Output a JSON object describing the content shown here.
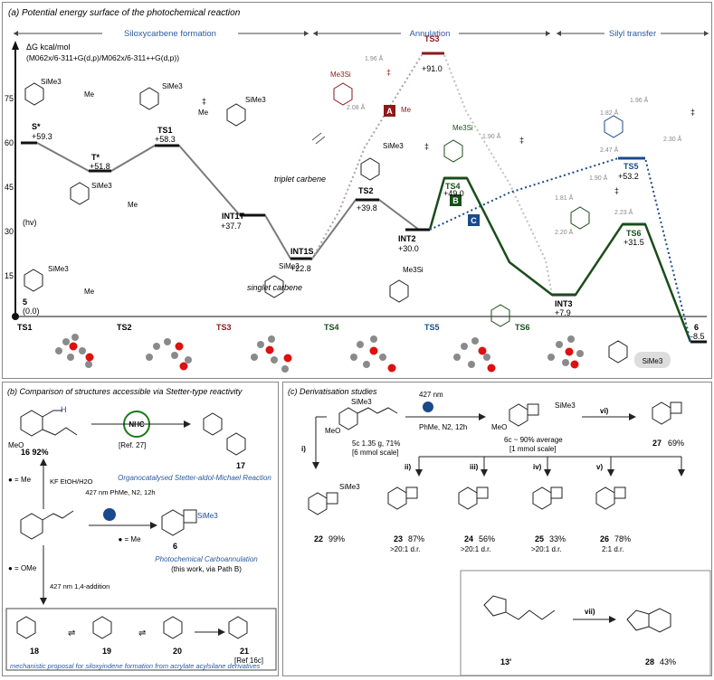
{
  "panel_a": {
    "title": "(a) Potential energy surface of the photochemical reaction",
    "phases": [
      "Siloxycarbene formation",
      "Annulation",
      "Silyl transfer"
    ],
    "y_unit": "ΔG kcal/mol",
    "method": "(M062x/6-311+G(d,p)/M062x/6-311++G(d,p))",
    "y_ticks": [
      "75",
      "60",
      "45",
      "30",
      "15"
    ],
    "hv": "(hv)",
    "states": [
      {
        "name": "S*",
        "value": "+59.3"
      },
      {
        "name": "T*",
        "value": "+51.8"
      },
      {
        "name": "TS1",
        "value": "+58.3"
      },
      {
        "name": "INT1T",
        "value": "+37.7"
      },
      {
        "name": "INT1S",
        "value": "+22.8"
      },
      {
        "name": "TS2",
        "value": "+39.8"
      },
      {
        "name": "INT2",
        "value": "+30.0"
      },
      {
        "name": "TS3",
        "value": "+91.0"
      },
      {
        "name": "TS4",
        "value": "+49.0"
      },
      {
        "name": "INT3",
        "value": "+7.9"
      },
      {
        "name": "TS5",
        "value": "+53.2"
      },
      {
        "name": "TS6",
        "value": "+31.5"
      },
      {
        "name": "6",
        "value": "-8.5"
      },
      {
        "name": "5",
        "value": "(0.0)"
      }
    ],
    "paths": [
      "A",
      "B",
      "C"
    ],
    "notes": {
      "triplet": "triplet carbene",
      "singlet": "singlet carbene"
    },
    "molecule_labels": [
      "SiMe3",
      "Me3Si",
      "Me",
      "O"
    ],
    "bond_lengths": [
      "1.96 Å",
      "2.08 Å",
      "1.90 Å",
      "1.82 Å",
      "2.47 Å",
      "2.30 Å",
      "1.81 Å",
      "2.20 Å",
      "2.23 Å"
    ],
    "ts_structures": [
      "TS1",
      "TS2",
      "TS3",
      "TS4",
      "TS5",
      "TS6"
    ],
    "colors": {
      "grey": "#7a7a7a",
      "red": "#8b1a1a",
      "green": "#1a4d1a",
      "blue": "#1a4a8b",
      "accent": "#2a5aa0"
    }
  },
  "panel_b": {
    "title": "(b) Comparison of structures accessible via Stetter-type reactivity",
    "cpd16": "16 92%",
    "nhc": "NHC",
    "ref27": "[Ref. 27]",
    "cpd17": "17",
    "cap17": "Organocatalysed Stetter-aldol-Michael Reaction",
    "me_note": "● = Me",
    "kf": "KF EtOH/H2O",
    "cond_b": "427 nm PhMe, N2, 12h",
    "me_note2": "● = Me",
    "cpd6": "6",
    "cap6": "Photochemical Carboannulation",
    "cap6b": "(this work, via Path B)",
    "ome_note": "● = OMe",
    "cond_ome": "427 nm 1,4-addition",
    "cpds": [
      "18",
      "19",
      "20",
      "21"
    ],
    "ref16c": "[Ref 16c]",
    "mech_caption": "mechanistic proposal for siloxyindene formation from acrylate acylsilane derivatives"
  },
  "panel_c": {
    "title": "(c) Derivatisation studies",
    "sm": "5c 1.35 g, 71%",
    "sm_scale": "[6 mmol scale]",
    "cond": "427 nm",
    "cond2": "PhMe, N2, 12h",
    "prod": "6c ~ 90% average",
    "prod_scale": "[1 mmol scale]",
    "steps": [
      "i)",
      "ii)",
      "iii)",
      "iv)",
      "v)",
      "vi)",
      "vii)"
    ],
    "products": [
      {
        "name": "22",
        "yield": "99%",
        "dr": ""
      },
      {
        "name": "23",
        "yield": "87%",
        "dr": ">20:1 d.r."
      },
      {
        "name": "24",
        "yield": "56%",
        "dr": ">20:1 d.r."
      },
      {
        "name": "25",
        "yield": "33%",
        "dr": ">20:1 d.r."
      },
      {
        "name": "26",
        "yield": "78%",
        "dr": "2:1 d.r."
      },
      {
        "name": "27",
        "yield": "69%",
        "dr": ""
      },
      {
        "name": "13'",
        "yield": "",
        "dr": ""
      },
      {
        "name": "28",
        "yield": "43%",
        "dr": ""
      }
    ]
  }
}
